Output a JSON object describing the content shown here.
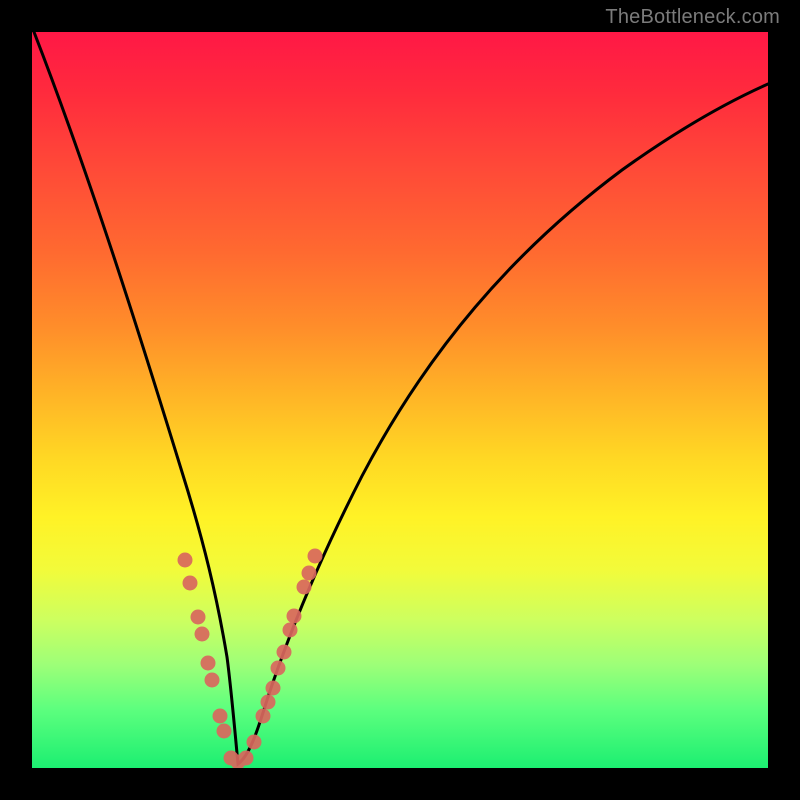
{
  "watermark": {
    "text": "TheBottleneck.com"
  },
  "chart_data": {
    "type": "line",
    "title": "",
    "xlabel": "",
    "ylabel": "",
    "xlim": [
      0,
      100
    ],
    "ylim": [
      0,
      100
    ],
    "series": [
      {
        "name": "curve",
        "x": [
          0,
          5,
          10,
          15,
          18,
          20,
          22,
          24,
          26,
          27,
          28,
          30,
          34,
          38,
          44,
          52,
          62,
          74,
          88,
          100
        ],
        "values": [
          100,
          80,
          62,
          45,
          35,
          27,
          19,
          12,
          6,
          3,
          0,
          4,
          14,
          26,
          40,
          55,
          67,
          77,
          84,
          88
        ]
      }
    ],
    "markers": {
      "name": "dotted-highlight",
      "color": "#d9685e",
      "points": [
        {
          "x": 20.5,
          "y": 28
        },
        {
          "x": 21.3,
          "y": 25
        },
        {
          "x": 22.4,
          "y": 20
        },
        {
          "x": 22.9,
          "y": 18
        },
        {
          "x": 23.7,
          "y": 14
        },
        {
          "x": 24.2,
          "y": 12
        },
        {
          "x": 25.3,
          "y": 7
        },
        {
          "x": 25.8,
          "y": 5
        },
        {
          "x": 26.8,
          "y": 1
        },
        {
          "x": 27.7,
          "y": 0.4
        },
        {
          "x": 28.8,
          "y": 1
        },
        {
          "x": 30.0,
          "y": 3
        },
        {
          "x": 31.2,
          "y": 7
        },
        {
          "x": 31.8,
          "y": 9
        },
        {
          "x": 32.4,
          "y": 11
        },
        {
          "x": 33.2,
          "y": 14
        },
        {
          "x": 34.0,
          "y": 16
        },
        {
          "x": 34.8,
          "y": 19
        },
        {
          "x": 35.4,
          "y": 21
        },
        {
          "x": 36.8,
          "y": 25
        },
        {
          "x": 37.4,
          "y": 27
        },
        {
          "x": 38.2,
          "y": 29
        }
      ]
    },
    "background_gradient": [
      "#ff1846",
      "#ff6a30",
      "#ffd824",
      "#ccff60",
      "#1cef71"
    ]
  }
}
